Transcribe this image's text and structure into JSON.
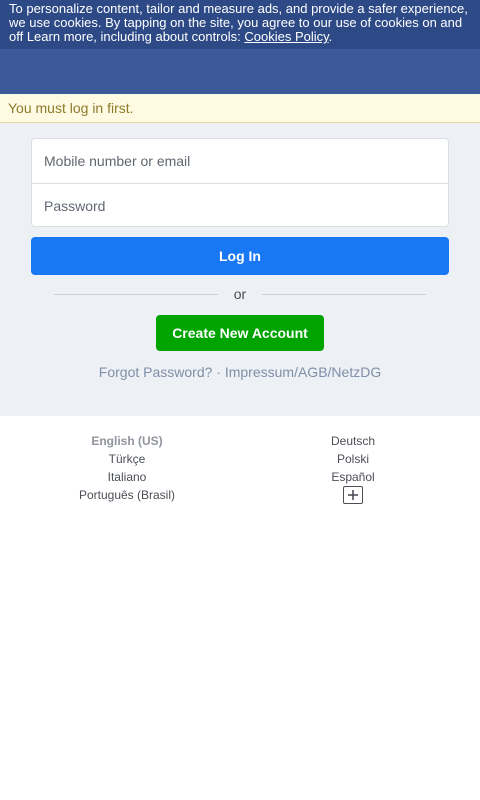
{
  "cookie_banner": {
    "text": "To personalize content, tailor and measure ads, and provide a safer experience, we use cookies. By tapping on the site, you agree to our use of cookies on and off  Learn more, including about controls: ",
    "link": "Cookies Policy",
    "after_link": "."
  },
  "notice": "You must log in first.",
  "login_form": {
    "email_placeholder": "Mobile number or email",
    "password_placeholder": "Password",
    "login_label": "Log In",
    "or_label": "or",
    "create_account_label": "Create New Account"
  },
  "links": {
    "forgot_password": "Forgot Password?",
    "separator": " · ",
    "impressum": "Impressum/AGB/NetzDG"
  },
  "languages": {
    "left": [
      "English (US)",
      "Türkçe",
      "Italiano",
      "Português (Brasil)"
    ],
    "right": [
      "Deutsch",
      "Polski",
      "Español"
    ],
    "more_icon": "plus-icon"
  },
  "colors": {
    "header": "#3b5998",
    "login_button": "#1877f2",
    "create_button": "#00a400",
    "notice_bg": "#fffbe2"
  }
}
